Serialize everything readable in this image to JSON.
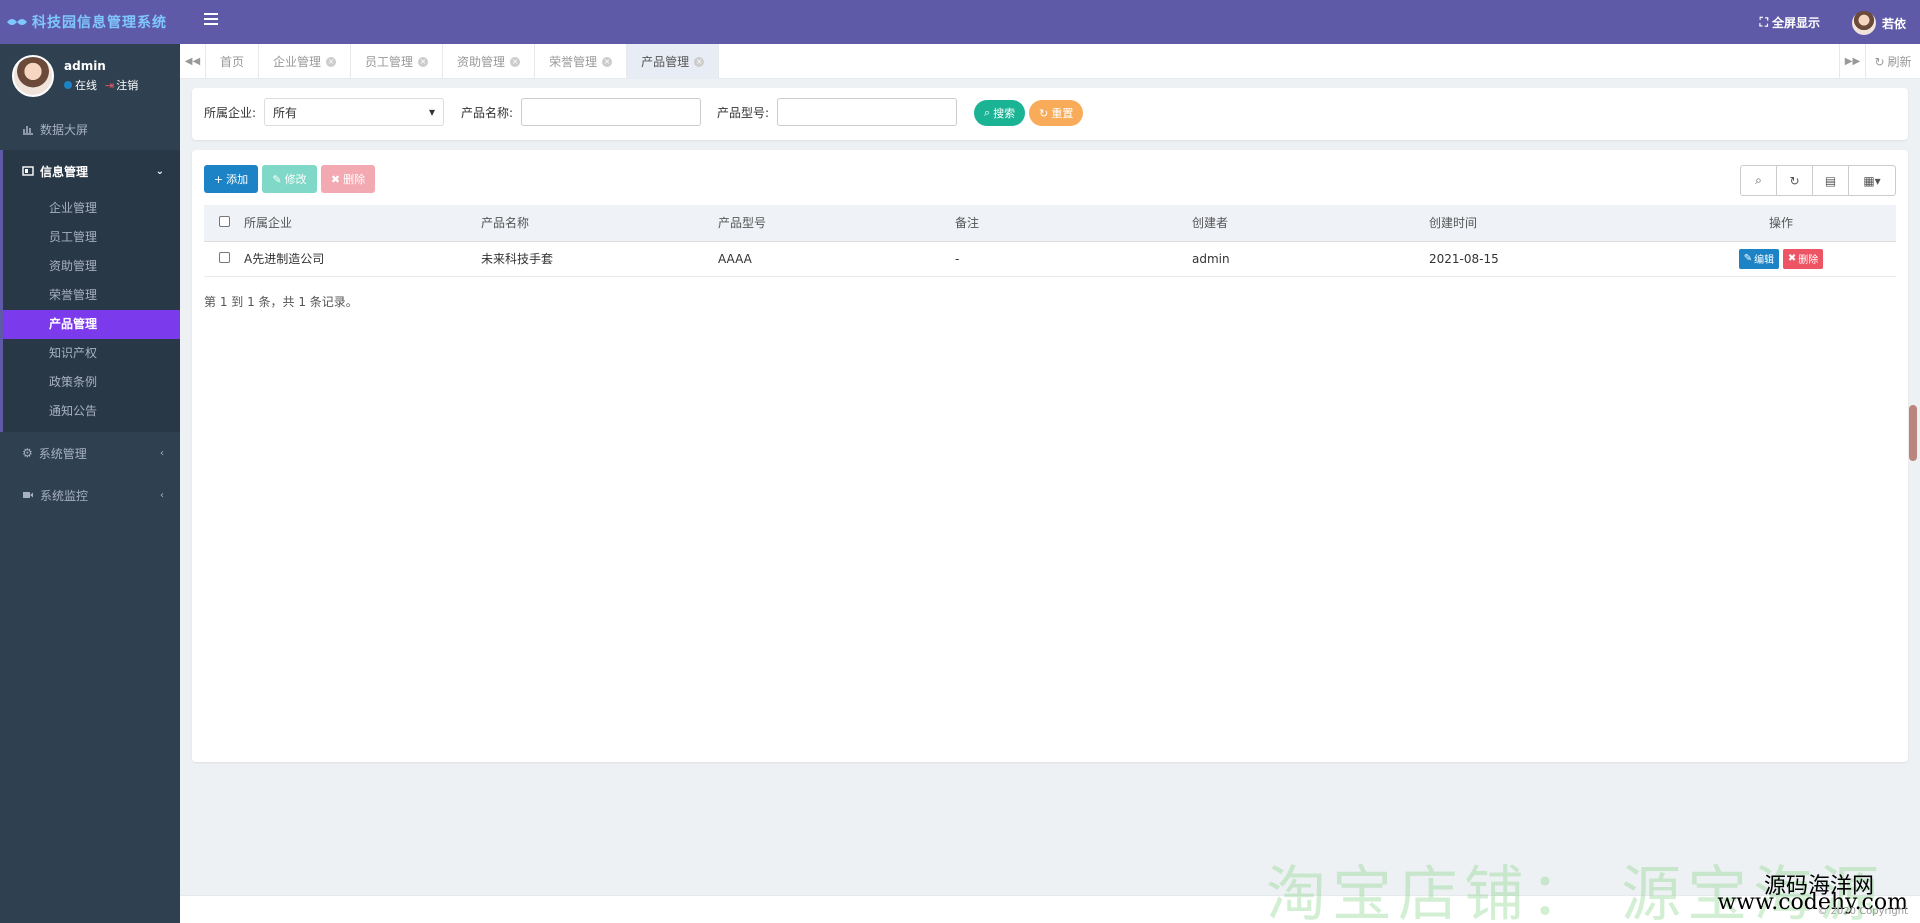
{
  "app": {
    "title": "科技园信息管理系统"
  },
  "user": {
    "name": "admin",
    "status": "在线",
    "logout": "注销"
  },
  "topbar": {
    "fullscreen": "全屏显示",
    "username": "若依"
  },
  "sidebar": {
    "items": [
      {
        "label": "数据大屏",
        "icon": "chart-icon"
      },
      {
        "label": "信息管理",
        "icon": "card-icon",
        "expanded": true,
        "children": [
          "企业管理",
          "员工管理",
          "资助管理",
          "荣誉管理",
          "产品管理",
          "知识产权",
          "政策条例",
          "通知公告"
        ],
        "active_child": "产品管理"
      },
      {
        "label": "系统管理",
        "icon": "gear-icon"
      },
      {
        "label": "系统监控",
        "icon": "video-icon"
      }
    ]
  },
  "tabs": {
    "items": [
      "首页",
      "企业管理",
      "员工管理",
      "资助管理",
      "荣誉管理",
      "产品管理"
    ],
    "active": "产品管理",
    "refresh": "刷新"
  },
  "search": {
    "company_label": "所属企业:",
    "company_value": "所有",
    "name_label": "产品名称:",
    "name_value": "",
    "model_label": "产品型号:",
    "model_value": "",
    "search_btn": "搜索",
    "reset_btn": "重置"
  },
  "toolbar": {
    "add": "添加",
    "edit": "修改",
    "delete": "删除"
  },
  "table": {
    "columns": [
      "所属企业",
      "产品名称",
      "产品型号",
      "备注",
      "创建者",
      "创建时间",
      "操作"
    ],
    "rows": [
      {
        "company": "A先进制造公司",
        "name": "未来科技手套",
        "model": "AAAA",
        "remark": "-",
        "creator": "admin",
        "created": "2021-08-15",
        "edit": "编辑",
        "delete": "删除"
      }
    ],
    "pager": "第 1 到 1 条，共 1 条记录。"
  },
  "footer": {
    "watermark": "淘宝店铺： 源宝海源",
    "brand_cn": "源码海洋网",
    "brand_url": "www.codehy.com",
    "copyright": "© 2020 Copyright"
  },
  "colors": {
    "primary": "#5e5aa8",
    "sidebar": "#2f4050",
    "active": "#7c3aed",
    "blue": "#1c84c6",
    "green": "#1ab394",
    "orange": "#f8ac59",
    "red": "#ed5565"
  }
}
